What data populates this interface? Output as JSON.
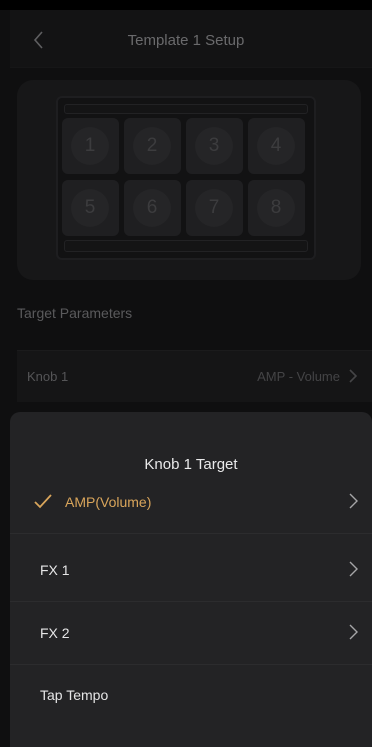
{
  "header": {
    "title": "Template 1 Setup"
  },
  "pads": [
    "1",
    "2",
    "3",
    "4",
    "5",
    "6",
    "7",
    "8"
  ],
  "section": {
    "label": "Target Parameters"
  },
  "param": {
    "name": "Knob 1",
    "value": "AMP - Volume"
  },
  "sheet": {
    "title": "Knob 1 Target",
    "options": [
      {
        "label": "AMP(Volume)",
        "selected": true,
        "has_chevron": true
      },
      {
        "label": "FX 1",
        "selected": false,
        "has_chevron": true
      },
      {
        "label": "FX 2",
        "selected": false,
        "has_chevron": true
      },
      {
        "label": "Tap Tempo",
        "selected": false,
        "has_chevron": false
      }
    ]
  },
  "colors": {
    "accent": "#d9a55b",
    "sheet_bg": "#232325"
  },
  "icons": {
    "back": "chevron-left-icon",
    "row": "chevron-right-icon",
    "check": "checkmark-icon"
  }
}
